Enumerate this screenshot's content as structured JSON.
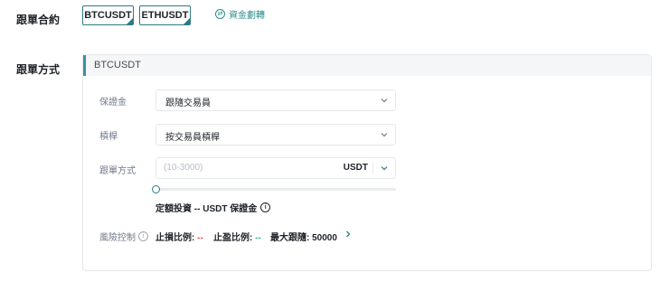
{
  "contract": {
    "label": "跟單合約",
    "pairs": [
      "BTCUSDT",
      "ETHUSDT"
    ],
    "transfer_label": "資金劃轉",
    "transfer_icon": "exchange-icon"
  },
  "copy_mode": {
    "label": "跟單方式",
    "panel_title": "BTCUSDT",
    "margin": {
      "label": "保證金",
      "value": "跟隨交易員"
    },
    "leverage": {
      "label": "槓桿",
      "value": "按交易員槓桿"
    },
    "amount": {
      "label": "跟單方式",
      "placeholder": "(10-3000)",
      "unit": "USDT",
      "slider_value": 0
    },
    "invest_text": "定額投資 -- USDT 保證金",
    "risk": {
      "label": "風險控制",
      "stop_loss_label": "止損比例:",
      "stop_loss_value": "--",
      "take_profit_label": "止盈比例:",
      "take_profit_value": "--",
      "max_follow_label": "最大跟隨:",
      "max_follow_value": "50000"
    }
  },
  "colors": {
    "accent": "#2c7a86",
    "negative": "#f6465d",
    "positive": "#2ebd85"
  }
}
